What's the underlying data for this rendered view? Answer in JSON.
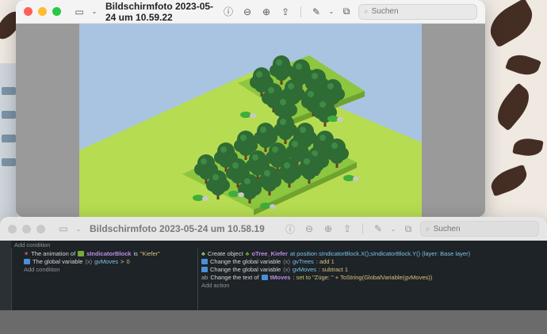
{
  "windows": {
    "front": {
      "title": "Bildschirmfoto 2023-05-24 um 10.59.22",
      "search_placeholder": "Suchen"
    },
    "back": {
      "title": "Bildschirmfoto 2023-05-24 um 10.58.19",
      "search_placeholder": "Suchen"
    }
  },
  "colors": {
    "close": "#ff5f57",
    "minimize": "#febc2e",
    "zoom": "#28c840",
    "sky": "#a8c4e0",
    "grass": "#b6dc52",
    "tile": "#8dc63f"
  },
  "events": {
    "header": "Add condition",
    "conditions": [
      {
        "prefix": "The animation of",
        "object": "sIndicatorBlock",
        "mid": "is",
        "value": "\"Kiefer\""
      },
      {
        "prefix": "The global variable",
        "object": "gvMoves",
        "mid": ">",
        "value": "0"
      }
    ],
    "add_condition": "Add condition",
    "actions": [
      {
        "prefix": "Create object",
        "object": "oTree_Kiefer",
        "rest": "at position sIndicatorBlock.X();sIndicatorBlock.Y() (layer: Base layer)"
      },
      {
        "prefix": "Change the global variable",
        "object": "gvTrees",
        "rest": ": add 1"
      },
      {
        "prefix": "Change the global variable",
        "object": "gvMoves",
        "rest": ": subtract 1"
      },
      {
        "prefix": "Change the text of",
        "object": "tMoves",
        "rest": ": set to \"Züge: \" + ToString(GlobalVariable(gvMoves))"
      }
    ],
    "add_action": "Add action"
  }
}
